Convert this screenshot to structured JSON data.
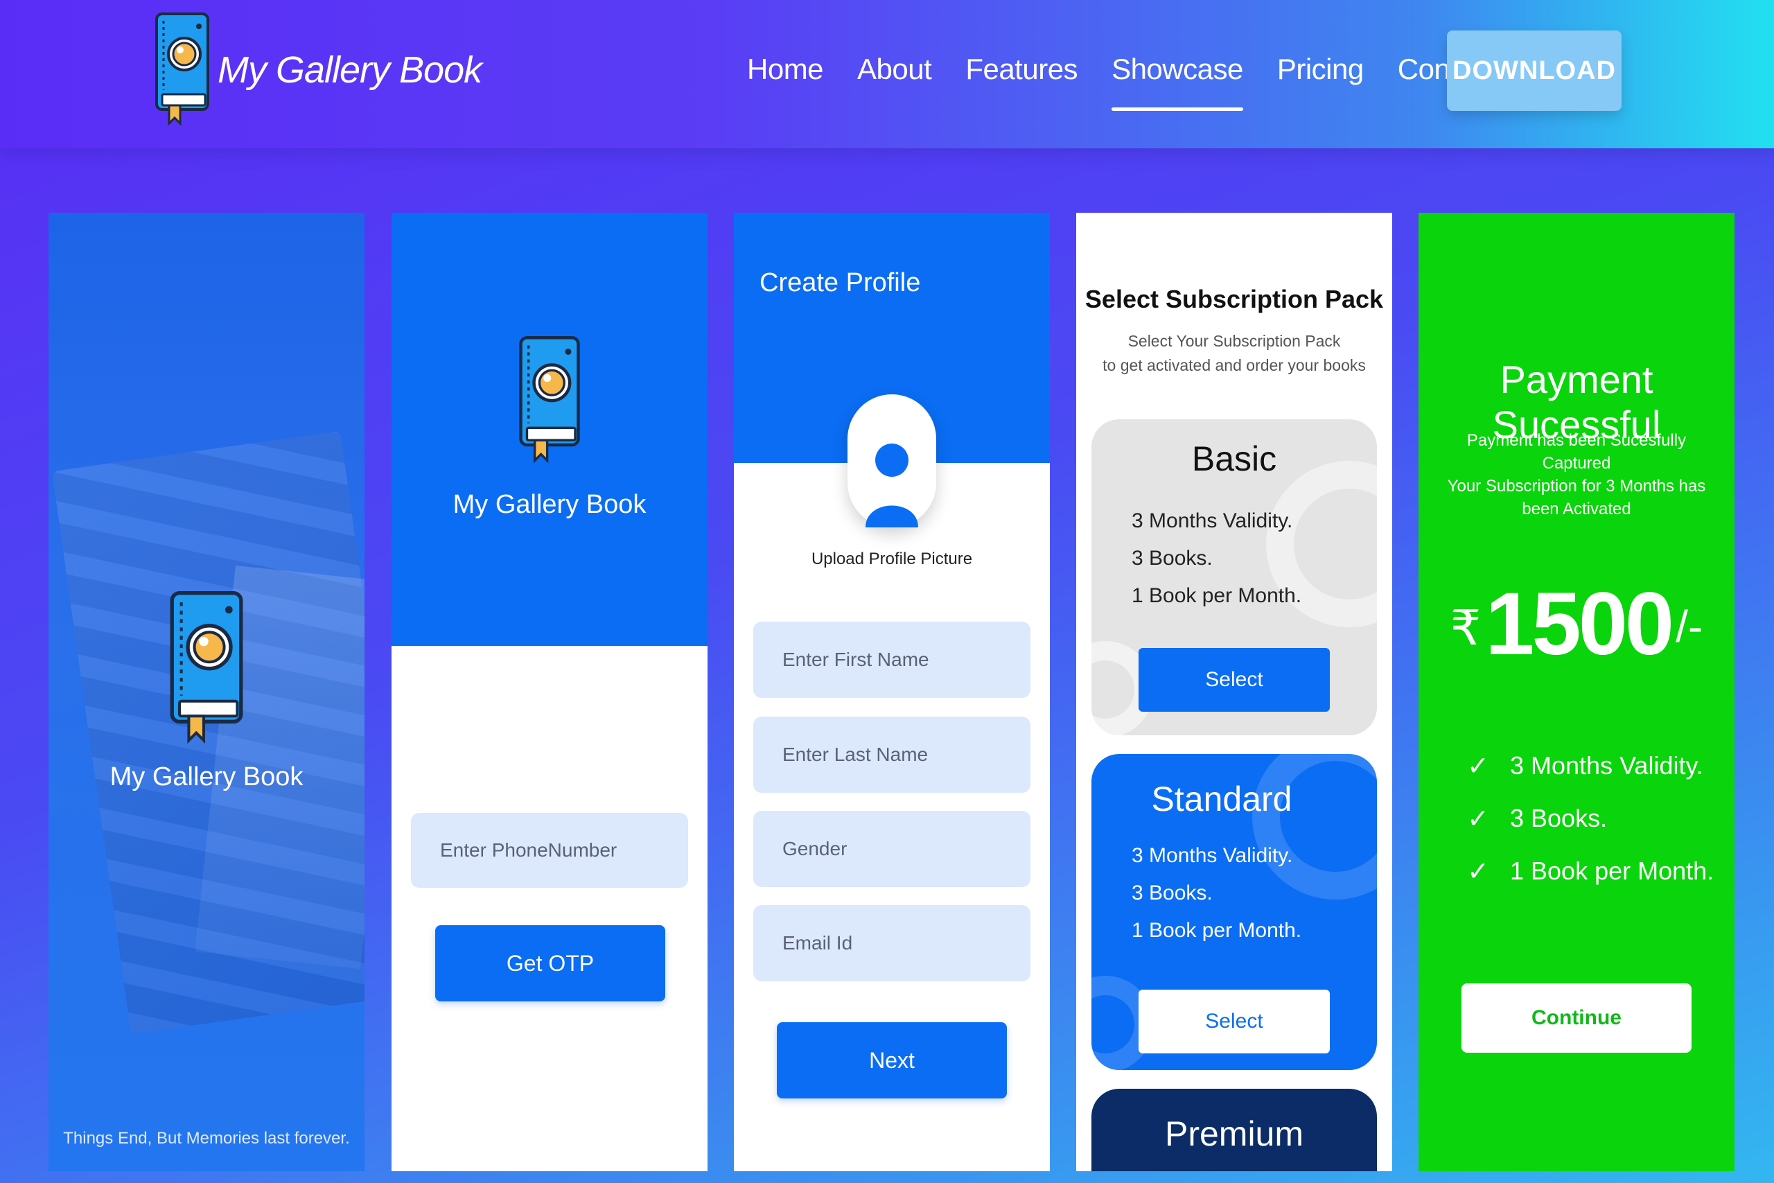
{
  "nav": {
    "brand": "My Gallery Book",
    "items": [
      {
        "label": "Home",
        "active": false
      },
      {
        "label": "About",
        "active": false
      },
      {
        "label": "Features",
        "active": false
      },
      {
        "label": "Showcase",
        "active": true
      },
      {
        "label": "Pricing",
        "active": false
      },
      {
        "label": "Contact",
        "active": false
      }
    ],
    "download_label": "DOWNLOAD"
  },
  "splash": {
    "app_name": "My Gallery Book",
    "tagline": "Things End, But Memories last forever."
  },
  "login": {
    "app_name": "My Gallery Book",
    "phone_placeholder": "Enter PhoneNumber",
    "otp_button": "Get OTP"
  },
  "profile": {
    "title": "Create Profile",
    "upload_label": "Upload Profile Picture",
    "first_name_placeholder": "Enter First Name",
    "last_name_placeholder": "Enter Last Name",
    "gender_placeholder": "Gender",
    "email_placeholder": "Email Id",
    "next_button": "Next"
  },
  "subscription": {
    "title": "Select Subscription Pack",
    "subtitle_line1": "Select Your Subscription Pack",
    "subtitle_line2": "to get activated and order your books",
    "plans": [
      {
        "name": "Basic",
        "features": [
          "3 Months Validity.",
          "3 Books.",
          "1 Book per Month."
        ],
        "select_label": "Select"
      },
      {
        "name": "Standard",
        "features": [
          "3 Months Validity.",
          "3 Books.",
          "1 Book per Month."
        ],
        "select_label": "Select"
      },
      {
        "name": "Premium"
      }
    ]
  },
  "payment": {
    "title": "Payment Sucessful",
    "message_line1": "Payment has been Sucesfully Captured",
    "message_line2": "Your Subscription for 3 Months has",
    "message_line3": "been Activated",
    "currency": "₹",
    "amount": "1500",
    "suffix": "/-",
    "features": [
      "3 Months Validity.",
      "3 Books.",
      "1 Book per Month."
    ],
    "continue_button": "Continue"
  },
  "colors": {
    "primary_blue": "#0a6df4",
    "success_green": "#0ad40b",
    "premium_navy": "#0b2c66"
  },
  "icons": {
    "logo": "book-camera-icon",
    "check": "check-icon",
    "avatar": "user-avatar-icon"
  }
}
